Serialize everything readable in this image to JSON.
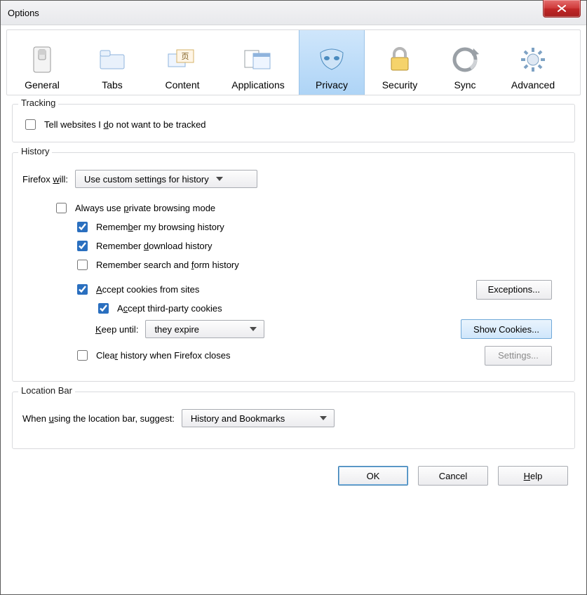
{
  "window": {
    "title": "Options"
  },
  "tabs": {
    "general": "General",
    "tabs": "Tabs",
    "content": "Content",
    "applications": "Applications",
    "privacy": "Privacy",
    "security": "Security",
    "sync": "Sync",
    "advanced": "Advanced"
  },
  "tracking": {
    "legend": "Tracking",
    "dnt_label_pre": "Tell websites I ",
    "dnt_label_u": "d",
    "dnt_label_post": "o not want to be tracked",
    "dnt_checked": false
  },
  "history": {
    "legend": "History",
    "firefox_will_pre": "Firefox ",
    "firefox_will_u": "w",
    "firefox_will_post": "ill:",
    "mode": "Use custom settings for history",
    "always_private_pre": "Always use ",
    "always_private_u": "p",
    "always_private_post": "rivate browsing mode",
    "always_private_checked": false,
    "remember_browsing_pre": "Remem",
    "remember_browsing_u": "b",
    "remember_browsing_post": "er my browsing history",
    "remember_browsing_checked": true,
    "remember_download_pre": "Remember ",
    "remember_download_u": "d",
    "remember_download_post": "ownload history",
    "remember_download_checked": true,
    "remember_form_pre": "Remember search and ",
    "remember_form_u": "f",
    "remember_form_post": "orm history",
    "remember_form_checked": false,
    "accept_cookies_u": "A",
    "accept_cookies_post": "ccept cookies from sites",
    "accept_cookies_checked": true,
    "exceptions": "Exceptions...",
    "accept_third_pre": "A",
    "accept_third_u": "c",
    "accept_third_post": "cept third-party cookies",
    "accept_third_checked": true,
    "keep_until_u": "K",
    "keep_until_post": "eep until:",
    "keep_until_value": "they expire",
    "show_cookies": "Show Cookies...",
    "clear_on_close_pre": "Clea",
    "clear_on_close_u": "r",
    "clear_on_close_post": " history when Firefox closes",
    "clear_on_close_checked": false,
    "settings": "Settings..."
  },
  "locationbar": {
    "legend": "Location Bar",
    "label_pre": "When ",
    "label_u": "u",
    "label_post": "sing the location bar, suggest:",
    "value": "History and Bookmarks"
  },
  "footer": {
    "ok": "OK",
    "cancel": "Cancel",
    "help_u": "H",
    "help_post": "elp"
  }
}
